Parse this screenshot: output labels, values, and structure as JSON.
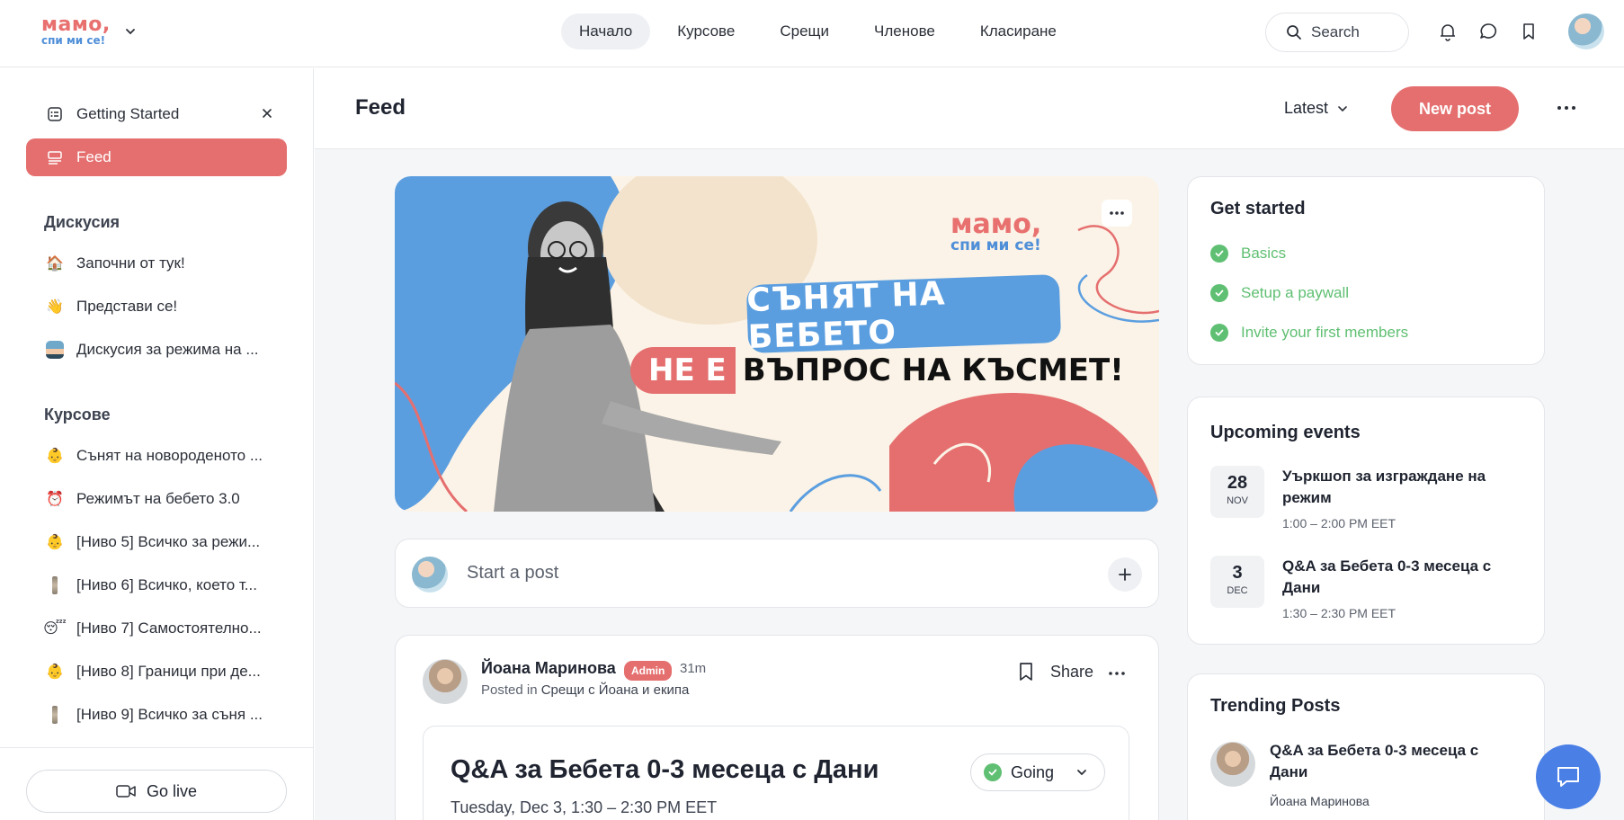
{
  "brand": {
    "logo_line1": "мамо,",
    "logo_line2": "спи ми се!",
    "accent": "#e56f6f",
    "blue": "#5b9ee0"
  },
  "nav": {
    "items": [
      {
        "label": "Начало",
        "active": true
      },
      {
        "label": "Курсове"
      },
      {
        "label": "Срещи"
      },
      {
        "label": "Членове"
      },
      {
        "label": "Класиране"
      }
    ]
  },
  "search": {
    "placeholder": "Search"
  },
  "sidebar": {
    "getting_started": "Getting Started",
    "feed": "Feed",
    "discussion_heading": "Дискусия",
    "discussion": [
      {
        "label": "Започни от тук!",
        "icon": "house-icon"
      },
      {
        "label": "Представи се!",
        "icon": "waving-hand-icon"
      },
      {
        "label": "Дискусия за режима на ...",
        "icon": "baby-icon"
      }
    ],
    "courses_heading": "Курсове",
    "courses": [
      {
        "label": "Сънят на новороденото ...",
        "icon": "baby-face-icon"
      },
      {
        "label": "Режимът на бебето 3.0",
        "icon": "alarm-clock-icon"
      },
      {
        "label": "[Ниво 5] Всичко за режи...",
        "icon": "baby-face-icon"
      },
      {
        "label": "[Ниво 6] Всичко, което т...",
        "icon": "bar-icon"
      },
      {
        "label": "[Ниво 7] Самостоятелно...",
        "icon": "sleepy-face-icon"
      },
      {
        "label": "[Ниво 8] Граници при де...",
        "icon": "baby-face-icon"
      },
      {
        "label": "[Ниво 9] Всичко за съня ...",
        "icon": "bar-icon"
      }
    ],
    "go_live": "Go live"
  },
  "feed": {
    "title": "Feed",
    "sort": "Latest",
    "new_post": "New post",
    "banner": {
      "logo_line1": "мамо,",
      "logo_line2": "спи ми се!",
      "line1": "СЪНЯТ НА БЕБЕТО",
      "line2_red": "НЕ Е",
      "line2_black": "ВЪПРОС НА КЪСМЕТ!"
    },
    "composer_placeholder": "Start a post",
    "post": {
      "author": "Йоана Маринова",
      "badge": "Admin",
      "time": "31m",
      "posted_prefix": "Posted in",
      "posted_in": "Срещи с Йоана и екипа",
      "share": "Share",
      "event_title": "Q&A за Бебета 0-3 месеца с Дани",
      "event_date": "Tuesday, Dec 3, 1:30 – 2:30 PM EET",
      "rsvp": "Going"
    }
  },
  "right": {
    "get_started": {
      "title": "Get started",
      "items": [
        "Basics",
        "Setup a paywall",
        "Invite your first members"
      ]
    },
    "events": {
      "title": "Upcoming events",
      "items": [
        {
          "day": "28",
          "month": "NOV",
          "title": "Уъркшоп за изграждане на режим",
          "time": "1:00 – 2:00 PM EET"
        },
        {
          "day": "3",
          "month": "DEC",
          "title": "Q&A за Бебета 0-3 месеца с Дани",
          "time": "1:30 – 2:30 PM EET"
        }
      ]
    },
    "trending": {
      "title": "Trending Posts",
      "items": [
        {
          "title": "Q&A за Бебета 0-3 месеца с Дани",
          "author": "Йоана Маринова"
        }
      ]
    }
  }
}
